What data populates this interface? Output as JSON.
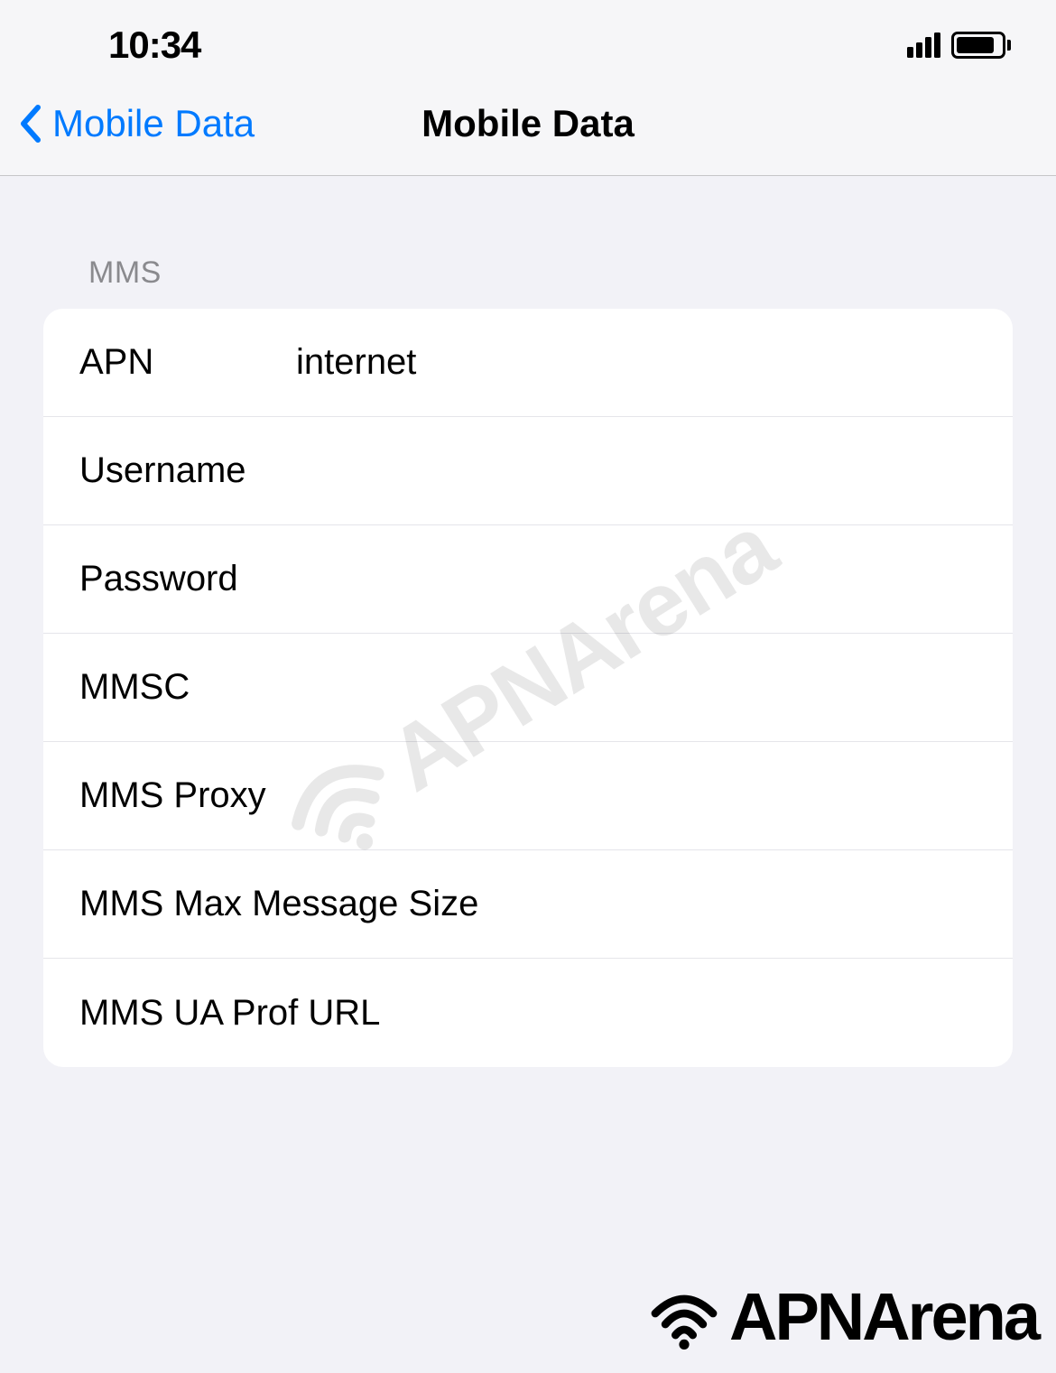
{
  "statusBar": {
    "time": "10:34"
  },
  "navBar": {
    "backLabel": "Mobile Data",
    "title": "Mobile Data"
  },
  "section": {
    "header": "MMS",
    "rows": [
      {
        "label": "APN",
        "value": "internet"
      },
      {
        "label": "Username",
        "value": ""
      },
      {
        "label": "Password",
        "value": ""
      },
      {
        "label": "MMSC",
        "value": ""
      },
      {
        "label": "MMS Proxy",
        "value": ""
      },
      {
        "label": "MMS Max Message Size",
        "value": ""
      },
      {
        "label": "MMS UA Prof URL",
        "value": ""
      }
    ]
  },
  "watermark": {
    "text": "APNArena"
  },
  "footer": {
    "brand": "APNArena"
  }
}
